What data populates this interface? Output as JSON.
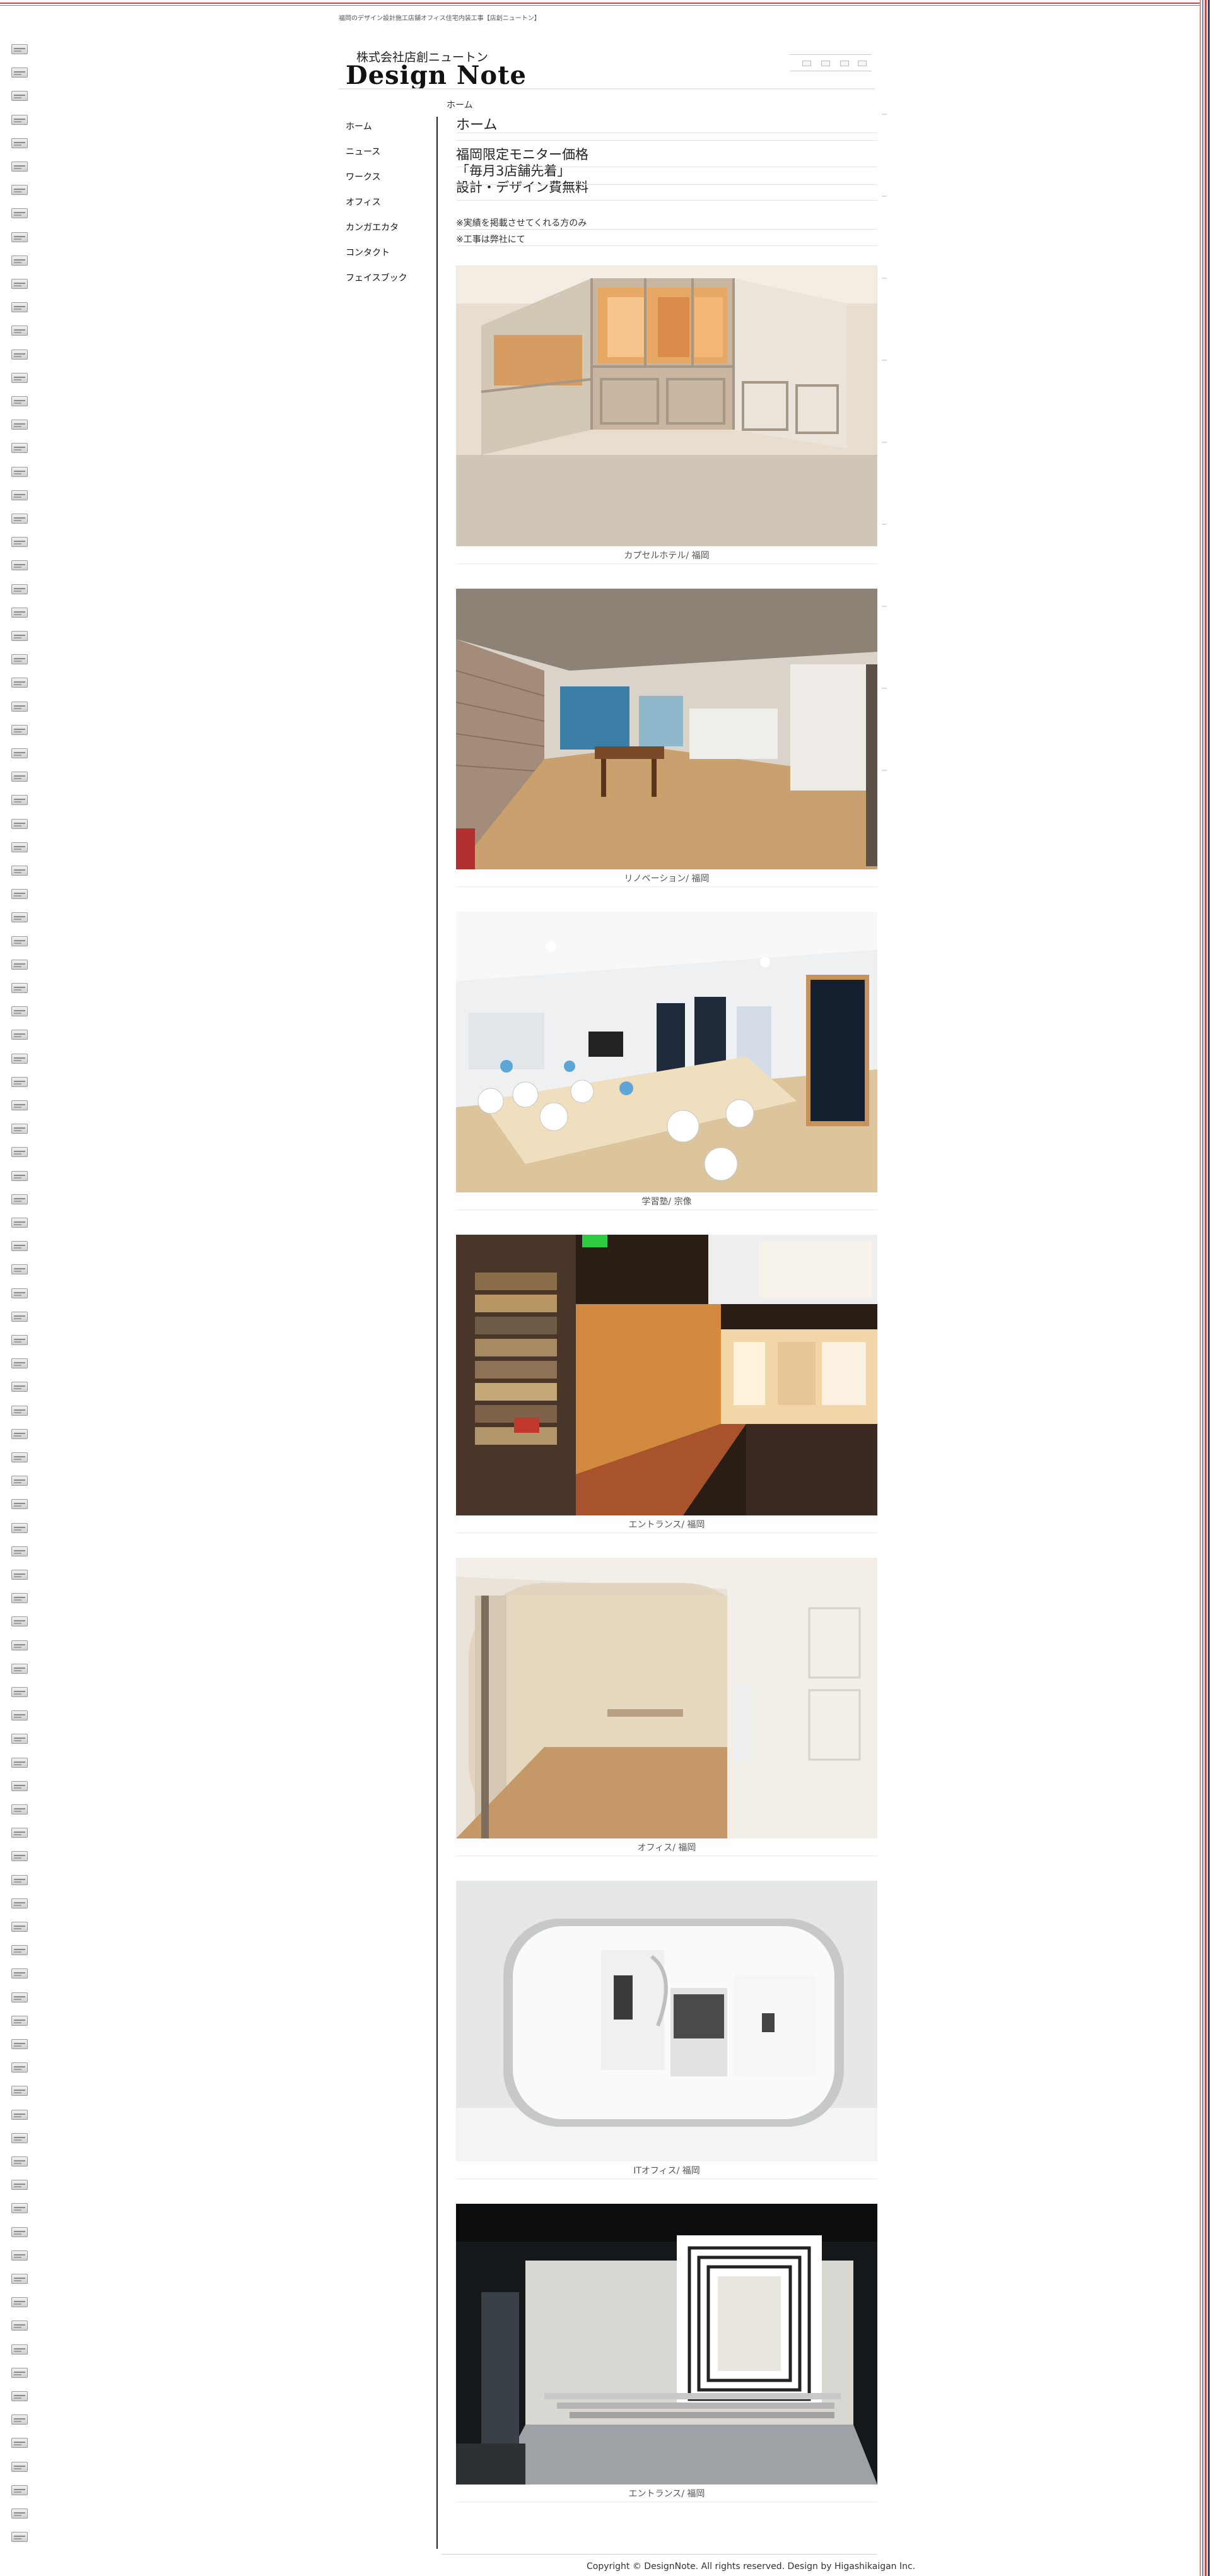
{
  "header": {
    "tagline": "福岡のデザイン設計施工店舗オフィス住宅内装工事【店創ニュートン】",
    "company_name": "株式会社店創ニュートン",
    "logo_text": "Design Note"
  },
  "breadcrumb": "ホーム",
  "nav": {
    "items": [
      {
        "label": "ホーム"
      },
      {
        "label": "ニュース"
      },
      {
        "label": "ワークス"
      },
      {
        "label": "オフィス"
      },
      {
        "label": "カンガエカタ"
      },
      {
        "label": "コンタクト"
      },
      {
        "label": "フェイスブック"
      }
    ]
  },
  "main": {
    "title": "ホーム",
    "promo": {
      "line1": "福岡限定モニター価格",
      "line2": "「毎月3店舗先着」",
      "line3": "設計・デザイン費無料"
    },
    "notes": {
      "note1": "※実績を掲載させてくれる方のみ",
      "note2": "※工事は弊社にて"
    },
    "gallery": [
      {
        "caption": "カプセルホテル/ 福岡",
        "icon": "capsule-hotel-photo"
      },
      {
        "caption": "リノベーション/ 福岡",
        "icon": "renovation-photo"
      },
      {
        "caption": "学習塾/ 宗像",
        "icon": "cram-school-photo"
      },
      {
        "caption": "エントランス/ 福岡",
        "icon": "entrance-photo"
      },
      {
        "caption": "オフィス/ 福岡",
        "icon": "office-photo"
      },
      {
        "caption": "ITオフィス/ 福岡",
        "icon": "it-office-photo"
      },
      {
        "caption": "エントランス/ 福岡",
        "icon": "entrance-night-photo"
      }
    ]
  },
  "footer": {
    "copyright": "Copyright © DesignNote. All rights reserved. Design by Higashikaigan Inc."
  },
  "colors": {
    "stripe_red": "#c9474c",
    "stripe_navy": "#3a3f66",
    "nav_rule": "#222222"
  }
}
